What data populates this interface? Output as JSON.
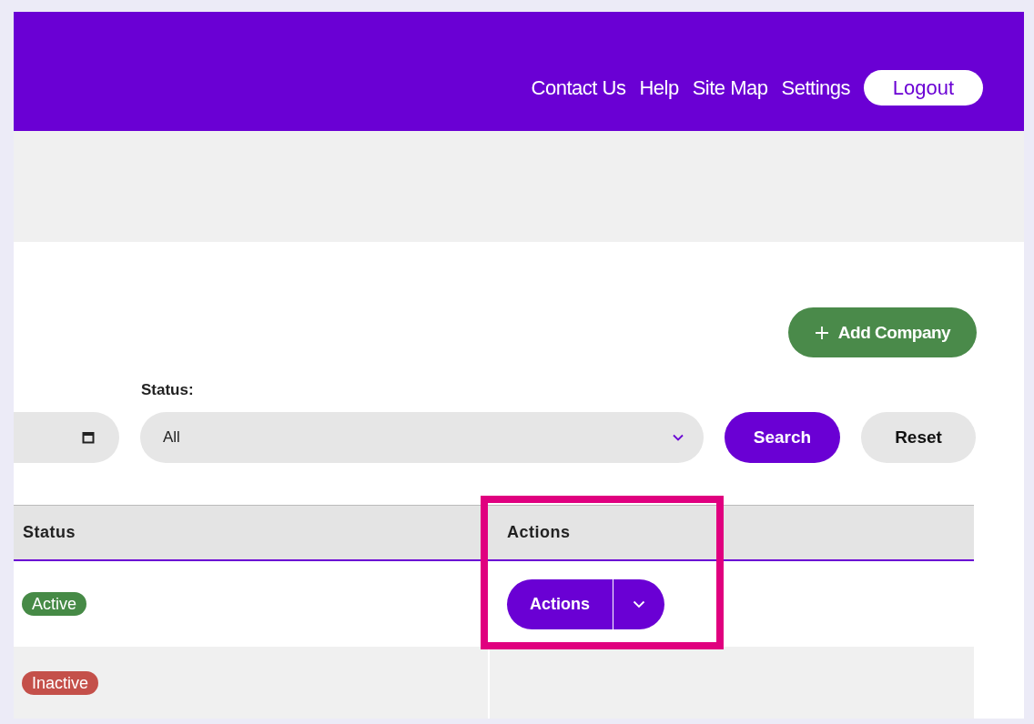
{
  "header": {
    "links": [
      "Contact Us",
      "Help",
      "Site Map",
      "Settings"
    ],
    "logout": "Logout"
  },
  "toolbar": {
    "add_button": "Add Company"
  },
  "filters": {
    "status_label": "Status:",
    "status_value": "All",
    "search_button": "Search",
    "reset_button": "Reset"
  },
  "table": {
    "columns": [
      "Status",
      "Actions"
    ],
    "rows": [
      {
        "status": "Active",
        "color": "#468a46",
        "actions": "Actions"
      },
      {
        "status": "Inactive",
        "color": "#c4504a"
      }
    ]
  }
}
